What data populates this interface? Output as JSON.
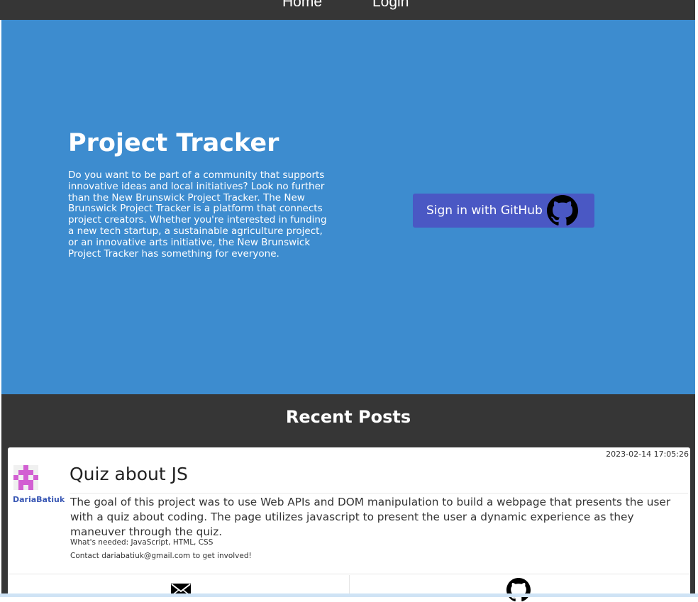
{
  "nav": {
    "home_label": "Home",
    "login_label": "Login"
  },
  "hero": {
    "title": "Project Tracker",
    "description": "Do you want to be part of a community that supports innovative ideas and local initiatives? Look no further than the New Brunswick Project Tracker. The New Brunswick Project Tracker is a platform that connects project creators. Whether you're interested in funding a new tech startup, a sustainable agriculture project, or an innovative arts initiative, the New Brunswick Project Tracker has something for everyone.",
    "signin_label": "Sign in with GitHub",
    "signin_icon": "github-icon"
  },
  "recent": {
    "title": "Recent Posts",
    "posts": [
      {
        "date": "2023-02-14 17:05:26",
        "author": "DariaBatiuk",
        "avatar_icon": "identicon-avatar",
        "title": "Quiz about JS",
        "body": "The goal of this project was to use Web APIs and DOM manipulation to build a webpage that presents the user with a quiz about coding. The page utilizes javascript to present the user a dynamic experience as they maneuver through the quiz.",
        "needed": "What's needed: JavaScript, HTML, CSS",
        "contact": "Contact dariabatiuk@gmail.com to get involved!",
        "actions": [
          "mail-icon",
          "github-icon"
        ]
      }
    ]
  },
  "colors": {
    "navbar_bg": "#363636",
    "hero_bg": "#3d8ccf",
    "signin_button_bg": "#4a58c4",
    "author_link": "#3a58b4",
    "avatar": "#d25fd2"
  }
}
